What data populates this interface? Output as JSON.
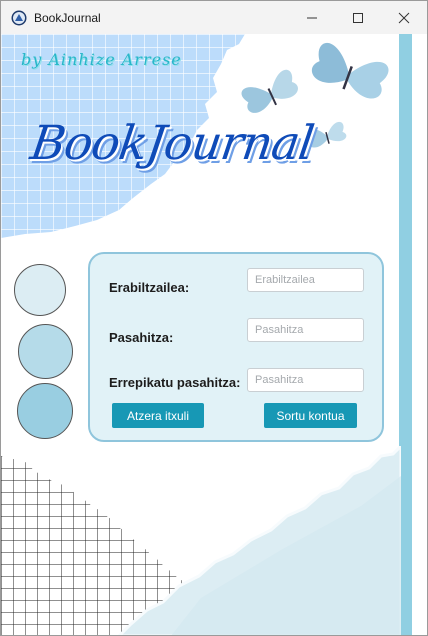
{
  "window": {
    "title": "BookJournal",
    "icon": "bookjournal-app-icon",
    "controls": [
      "minimize-icon",
      "maximize-icon",
      "close-icon"
    ]
  },
  "header": {
    "byline": "by Ainhize Arrese",
    "title": "BookJournal"
  },
  "form": {
    "username_label": "Erabiltzailea:",
    "username_placeholder": "Erabiltzailea",
    "username_value": "",
    "password_label": "Pasahitza:",
    "password_placeholder": "Pasahitza",
    "password_value": "",
    "repeat_label": "Errepikatu pasahitza:",
    "repeat_placeholder": "Pasahitza",
    "repeat_value": "",
    "back_button": "Atzera itxuli",
    "create_button": "Sortu kontua"
  },
  "colors": {
    "accent": "#1798b5",
    "title": "#0f4bb8",
    "byline": "#28b7c9",
    "card": "#e1f2f7",
    "stripe": "#90cfe2"
  }
}
